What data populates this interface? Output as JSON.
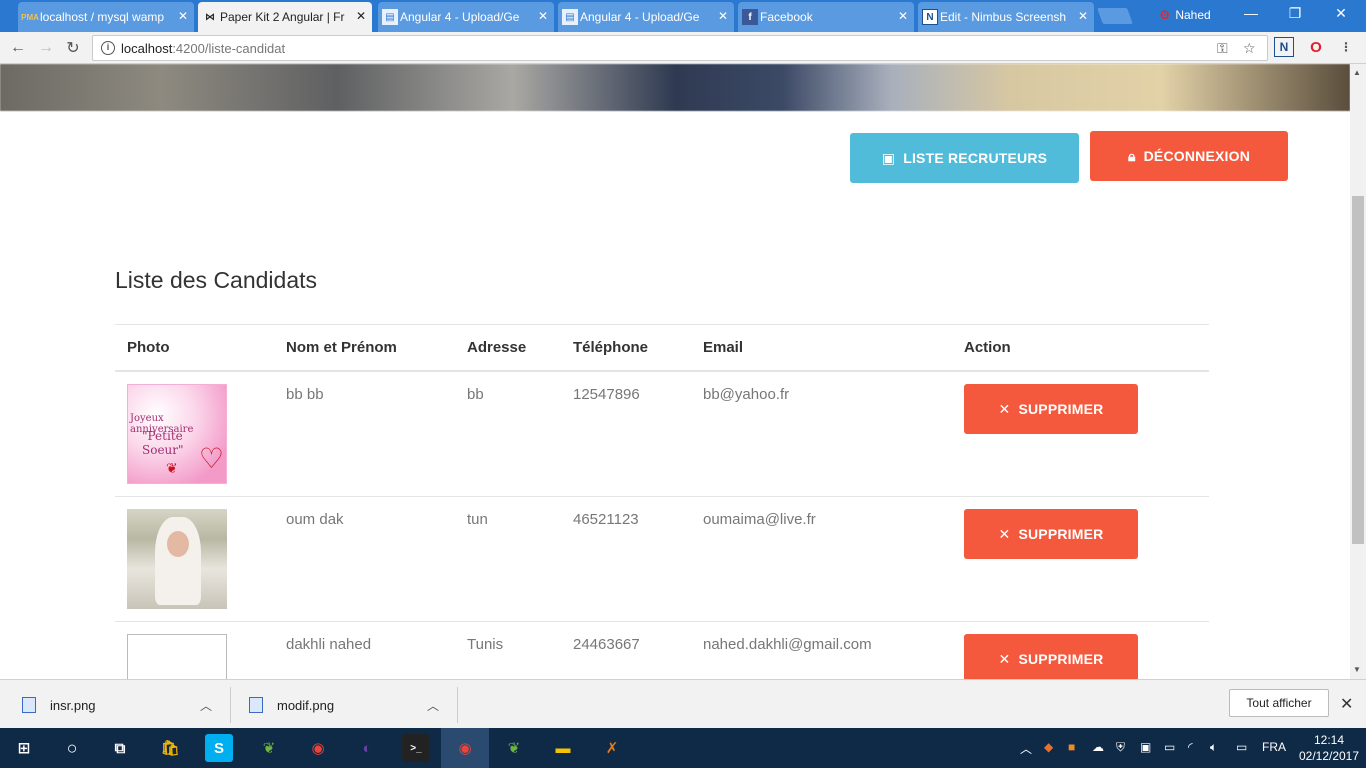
{
  "browser": {
    "tabs": [
      {
        "title": "localhost / mysql wamp",
        "favicon": "PMA",
        "active": false
      },
      {
        "title": "Paper Kit 2 Angular | Fr",
        "favicon": "bow",
        "active": true
      },
      {
        "title": "Angular 4 - Upload/Ge",
        "favicon": "doc",
        "active": false
      },
      {
        "title": "Angular 4 - Upload/Ge",
        "favicon": "doc",
        "active": false
      },
      {
        "title": "Facebook",
        "favicon": "f",
        "active": false
      },
      {
        "title": "Edit - Nimbus Screensh",
        "favicon": "N",
        "active": false
      }
    ],
    "profile_name": "Nahed",
    "url_host": "localhost",
    "url_path": ":4200/liste-candidat"
  },
  "header": {
    "recruiters_button": "LISTE RECRUTEURS",
    "logout_button": "DÉCONNEXION"
  },
  "main": {
    "title": "Liste des Candidats",
    "columns": [
      "Photo",
      "Nom et Prénom",
      "Adresse",
      "Téléphone",
      "Email",
      "Action"
    ],
    "rows": [
      {
        "name": "bb bb",
        "address": "bb",
        "phone": "12547896",
        "email": "bb@yahoo.fr",
        "action": "SUPPRIMER",
        "photo_text_1": "Joyeux anniversaire",
        "photo_text_2": "\"Petite Soeur\""
      },
      {
        "name": "oum dak",
        "address": "tun",
        "phone": "46521123",
        "email": "oumaima@live.fr",
        "action": "SUPPRIMER"
      },
      {
        "name": "dakhli nahed",
        "address": "Tunis",
        "phone": "24463667",
        "email": "nahed.dakhli@gmail.com",
        "action": "SUPPRIMER"
      }
    ]
  },
  "downloads": {
    "items": [
      {
        "name": "insr.png"
      },
      {
        "name": "modif.png"
      }
    ],
    "show_all": "Tout afficher"
  },
  "taskbar": {
    "language": "FRA",
    "time": "12:14",
    "date": "02/12/2017"
  },
  "colors": {
    "info": "#51bcda",
    "danger": "#f5593d",
    "chrome_blue": "#2b78d0",
    "taskbar": "#0f2a47"
  }
}
